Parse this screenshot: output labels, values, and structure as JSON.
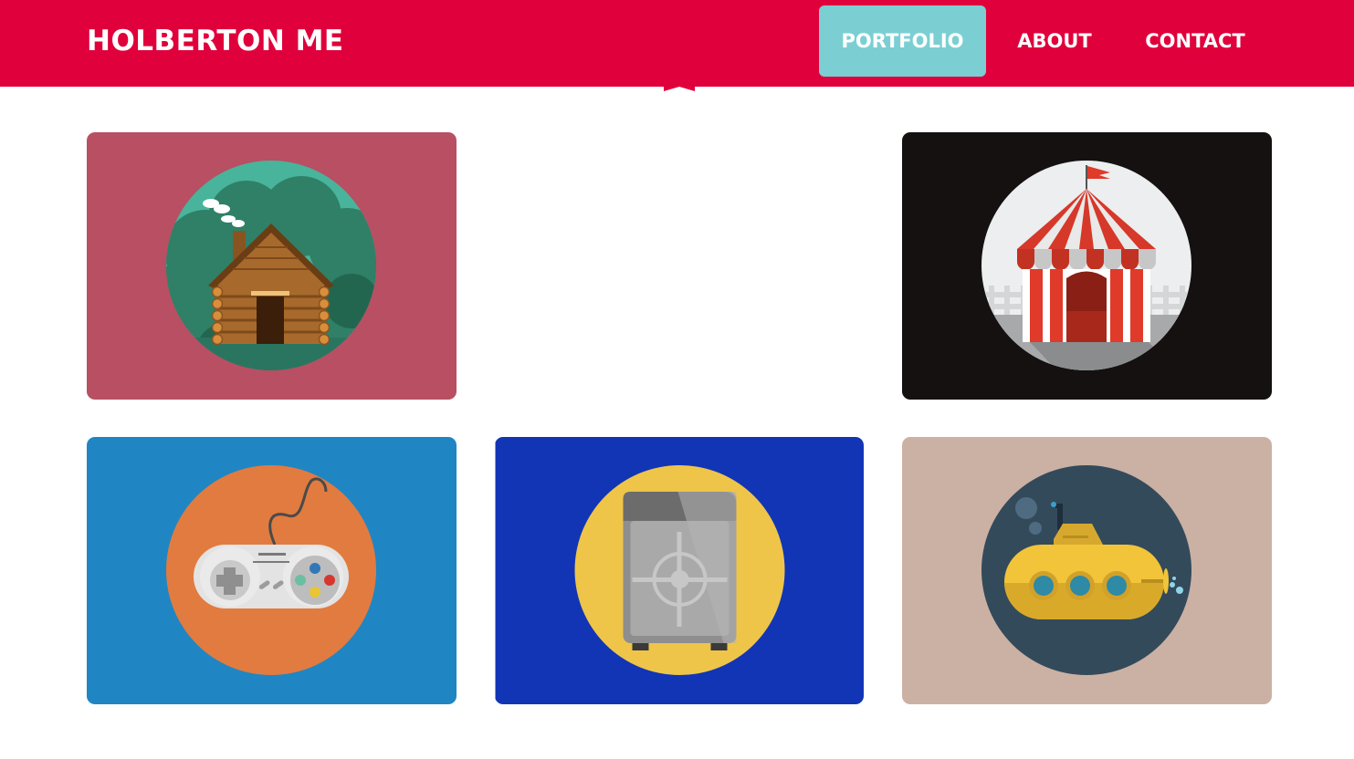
{
  "header": {
    "brand": "HOLBERTON ME",
    "nav": {
      "portfolio": "PORTFOLIO",
      "about": "ABOUT",
      "contact": "CONTACT"
    },
    "active_item": "PORTFOLIO"
  },
  "colors": {
    "navbar": "#e0003b",
    "active_nav": "#7bcfd3",
    "text": "#ffffff"
  },
  "portfolio": {
    "items": [
      {
        "icon": "log-cabin-icon",
        "background": "#b84f62",
        "circle": "#48b49b"
      },
      {
        "icon": "circus-tent-icon",
        "background": "#141110",
        "circle": "#eceeef"
      },
      {
        "icon": "game-controller-icon",
        "background": "#1f86c3",
        "circle": "#e27b3f"
      },
      {
        "icon": "safe-icon",
        "background": "#1235b6",
        "circle": "#eec549"
      },
      {
        "icon": "submarine-icon",
        "background": "#cbb1a3",
        "circle": "#334a5b"
      }
    ]
  }
}
